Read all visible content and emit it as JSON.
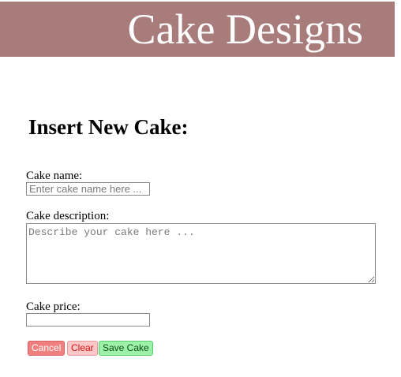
{
  "header": {
    "title": "Cake Designs"
  },
  "form": {
    "heading": "Insert New Cake:",
    "name": {
      "label": "Cake name:",
      "placeholder": "Enter cake name here ...",
      "value": ""
    },
    "description": {
      "label": "Cake description:",
      "placeholder": "Describe your cake here ...",
      "value": ""
    },
    "price": {
      "label": "Cake price:",
      "placeholder": "",
      "value": ""
    },
    "buttons": {
      "cancel": "Cancel",
      "clear": "Clear",
      "save": "Save Cake"
    }
  },
  "colors": {
    "banner": "#a97c7c",
    "cancel_bg": "#f08080",
    "clear_bg": "#ffc8c8",
    "save_bg": "#9cf2a8"
  }
}
